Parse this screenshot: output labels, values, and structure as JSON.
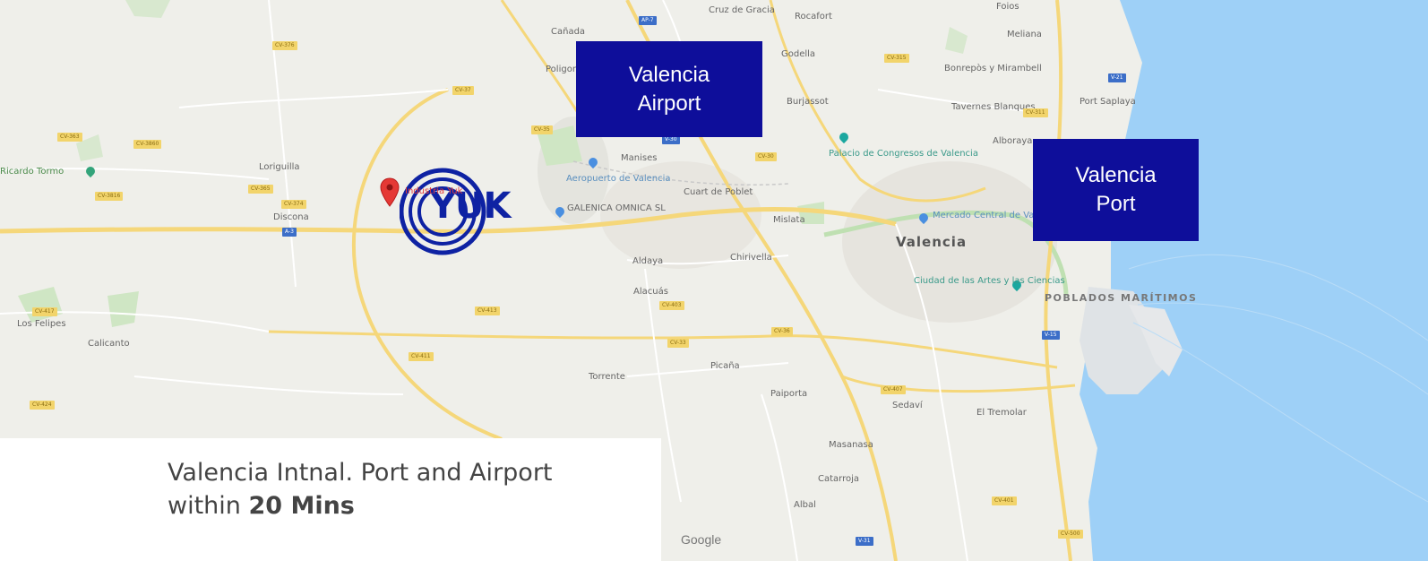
{
  "map": {
    "provider": "Google",
    "colors": {
      "land": "#efefea",
      "sea": "#9ed0f7",
      "highway": "#f5d77a",
      "road": "#ffffff",
      "park": "#cfe6c4",
      "callout": "#0e0e9a"
    },
    "places": [
      {
        "name": "Cruz de Gracia"
      },
      {
        "name": "Rocafort"
      },
      {
        "name": "Foios"
      },
      {
        "name": "Cañada"
      },
      {
        "name": "Godella"
      },
      {
        "name": "Meliana"
      },
      {
        "name": "Bonrepòs y Mirambell"
      },
      {
        "name": "Burjassot"
      },
      {
        "name": "Port Saplaya"
      },
      {
        "name": "Tavernes Blanques"
      },
      {
        "name": "Alboraya"
      },
      {
        "name": "Manises"
      },
      {
        "name": "Loriguilla"
      },
      {
        "name": "Cuart de Poblet"
      },
      {
        "name": "Mislata"
      },
      {
        "name": "Aldaya"
      },
      {
        "name": "Chirivella"
      },
      {
        "name": "Alacuás"
      },
      {
        "name": "Los Felipes"
      },
      {
        "name": "Calicanto"
      },
      {
        "name": "Torrente"
      },
      {
        "name": "Picaña"
      },
      {
        "name": "Paiporta"
      },
      {
        "name": "Sedaví"
      },
      {
        "name": "El Tremolar"
      },
      {
        "name": "Masanasa"
      },
      {
        "name": "Catarroja"
      },
      {
        "name": "Albal"
      },
      {
        "name": "Poligono Fuente"
      },
      {
        "name": "Discona"
      }
    ],
    "city": "Valencia",
    "district": "POBLADOS MARÍTIMOS",
    "pois": [
      {
        "name": "Ricardo Tormo",
        "icon": "circuit-pin-icon"
      },
      {
        "name": "Aeropuerto de Valencia",
        "icon": "airport-pin-icon"
      },
      {
        "name": "GALENICA OMNICA SL",
        "icon": "place-pin-icon"
      },
      {
        "name": "Palacio de Congresos de Valencia",
        "icon": "landmark-pin-icon"
      },
      {
        "name": "Mercado Central de Valencia",
        "icon": "place-pin-icon"
      },
      {
        "name": "Ciudad de las Artes y las Ciencias",
        "icon": "landmark-pin-icon"
      }
    ],
    "road_shields": [
      {
        "label": "CV-376",
        "kind": "cv"
      },
      {
        "label": "AP-7",
        "kind": "a"
      },
      {
        "label": "CV-37",
        "kind": "cv"
      },
      {
        "label": "CV-363",
        "kind": "cv"
      },
      {
        "label": "CV-3860",
        "kind": "cv"
      },
      {
        "label": "CV-365",
        "kind": "cv"
      },
      {
        "label": "CV-3816",
        "kind": "cv"
      },
      {
        "label": "CV-374",
        "kind": "cv"
      },
      {
        "label": "A-3",
        "kind": "a"
      },
      {
        "label": "CV-35",
        "kind": "cv"
      },
      {
        "label": "CV-315",
        "kind": "cv"
      },
      {
        "label": "V-21",
        "kind": "a"
      },
      {
        "label": "CV-311",
        "kind": "cv"
      },
      {
        "label": "CV-30",
        "kind": "cv"
      },
      {
        "label": "V-30",
        "kind": "a"
      },
      {
        "label": "CV-413",
        "kind": "cv"
      },
      {
        "label": "CV-403",
        "kind": "cv"
      },
      {
        "label": "CV-33",
        "kind": "cv"
      },
      {
        "label": "CV-36",
        "kind": "cv"
      },
      {
        "label": "V-15",
        "kind": "a"
      },
      {
        "label": "CV-407",
        "kind": "cv"
      },
      {
        "label": "CV-411",
        "kind": "cv"
      },
      {
        "label": "CV-417",
        "kind": "cv"
      },
      {
        "label": "CV-424",
        "kind": "cv"
      },
      {
        "label": "CV-401",
        "kind": "cv"
      },
      {
        "label": "CV-500",
        "kind": "cv"
      },
      {
        "label": "V-31",
        "kind": "a"
      }
    ],
    "logo": {
      "text": "YUK",
      "sub": "Industria Yuk"
    },
    "google_label": "Google"
  },
  "callouts": [
    {
      "id": "airport",
      "line1": "Valencia",
      "line2": "Airport"
    },
    {
      "id": "port",
      "line1": "Valencia",
      "line2": "Port"
    }
  ],
  "caption": {
    "line1": "Valencia Intnal. Port and Airport",
    "line2_prefix": "within ",
    "line2_bold": "20 Mins"
  }
}
